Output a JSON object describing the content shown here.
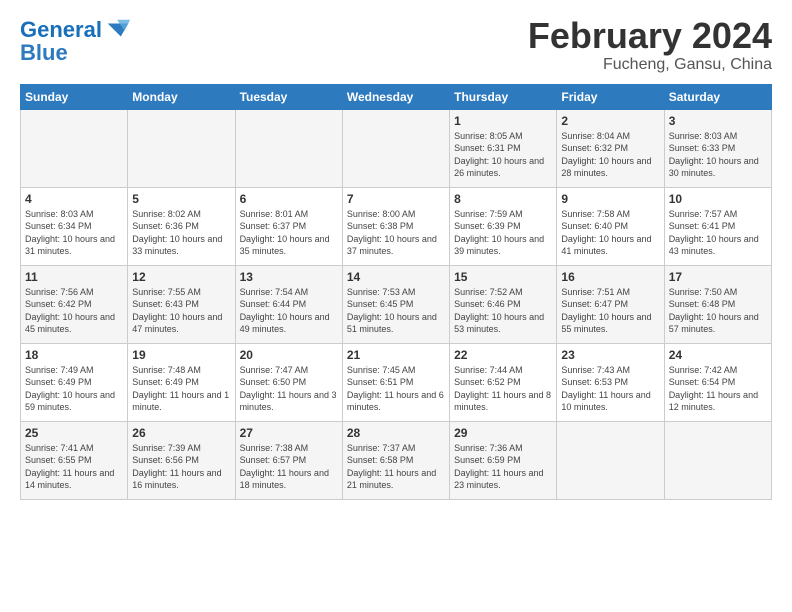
{
  "logo": {
    "line1": "General",
    "line2": "Blue"
  },
  "title": "February 2024",
  "subtitle": "Fucheng, Gansu, China",
  "headers": [
    "Sunday",
    "Monday",
    "Tuesday",
    "Wednesday",
    "Thursday",
    "Friday",
    "Saturday"
  ],
  "weeks": [
    [
      {
        "day": "",
        "sunrise": "",
        "sunset": "",
        "daylight": ""
      },
      {
        "day": "",
        "sunrise": "",
        "sunset": "",
        "daylight": ""
      },
      {
        "day": "",
        "sunrise": "",
        "sunset": "",
        "daylight": ""
      },
      {
        "day": "",
        "sunrise": "",
        "sunset": "",
        "daylight": ""
      },
      {
        "day": "1",
        "sunrise": "Sunrise: 8:05 AM",
        "sunset": "Sunset: 6:31 PM",
        "daylight": "Daylight: 10 hours and 26 minutes."
      },
      {
        "day": "2",
        "sunrise": "Sunrise: 8:04 AM",
        "sunset": "Sunset: 6:32 PM",
        "daylight": "Daylight: 10 hours and 28 minutes."
      },
      {
        "day": "3",
        "sunrise": "Sunrise: 8:03 AM",
        "sunset": "Sunset: 6:33 PM",
        "daylight": "Daylight: 10 hours and 30 minutes."
      }
    ],
    [
      {
        "day": "4",
        "sunrise": "Sunrise: 8:03 AM",
        "sunset": "Sunset: 6:34 PM",
        "daylight": "Daylight: 10 hours and 31 minutes."
      },
      {
        "day": "5",
        "sunrise": "Sunrise: 8:02 AM",
        "sunset": "Sunset: 6:36 PM",
        "daylight": "Daylight: 10 hours and 33 minutes."
      },
      {
        "day": "6",
        "sunrise": "Sunrise: 8:01 AM",
        "sunset": "Sunset: 6:37 PM",
        "daylight": "Daylight: 10 hours and 35 minutes."
      },
      {
        "day": "7",
        "sunrise": "Sunrise: 8:00 AM",
        "sunset": "Sunset: 6:38 PM",
        "daylight": "Daylight: 10 hours and 37 minutes."
      },
      {
        "day": "8",
        "sunrise": "Sunrise: 7:59 AM",
        "sunset": "Sunset: 6:39 PM",
        "daylight": "Daylight: 10 hours and 39 minutes."
      },
      {
        "day": "9",
        "sunrise": "Sunrise: 7:58 AM",
        "sunset": "Sunset: 6:40 PM",
        "daylight": "Daylight: 10 hours and 41 minutes."
      },
      {
        "day": "10",
        "sunrise": "Sunrise: 7:57 AM",
        "sunset": "Sunset: 6:41 PM",
        "daylight": "Daylight: 10 hours and 43 minutes."
      }
    ],
    [
      {
        "day": "11",
        "sunrise": "Sunrise: 7:56 AM",
        "sunset": "Sunset: 6:42 PM",
        "daylight": "Daylight: 10 hours and 45 minutes."
      },
      {
        "day": "12",
        "sunrise": "Sunrise: 7:55 AM",
        "sunset": "Sunset: 6:43 PM",
        "daylight": "Daylight: 10 hours and 47 minutes."
      },
      {
        "day": "13",
        "sunrise": "Sunrise: 7:54 AM",
        "sunset": "Sunset: 6:44 PM",
        "daylight": "Daylight: 10 hours and 49 minutes."
      },
      {
        "day": "14",
        "sunrise": "Sunrise: 7:53 AM",
        "sunset": "Sunset: 6:45 PM",
        "daylight": "Daylight: 10 hours and 51 minutes."
      },
      {
        "day": "15",
        "sunrise": "Sunrise: 7:52 AM",
        "sunset": "Sunset: 6:46 PM",
        "daylight": "Daylight: 10 hours and 53 minutes."
      },
      {
        "day": "16",
        "sunrise": "Sunrise: 7:51 AM",
        "sunset": "Sunset: 6:47 PM",
        "daylight": "Daylight: 10 hours and 55 minutes."
      },
      {
        "day": "17",
        "sunrise": "Sunrise: 7:50 AM",
        "sunset": "Sunset: 6:48 PM",
        "daylight": "Daylight: 10 hours and 57 minutes."
      }
    ],
    [
      {
        "day": "18",
        "sunrise": "Sunrise: 7:49 AM",
        "sunset": "Sunset: 6:49 PM",
        "daylight": "Daylight: 10 hours and 59 minutes."
      },
      {
        "day": "19",
        "sunrise": "Sunrise: 7:48 AM",
        "sunset": "Sunset: 6:49 PM",
        "daylight": "Daylight: 11 hours and 1 minute."
      },
      {
        "day": "20",
        "sunrise": "Sunrise: 7:47 AM",
        "sunset": "Sunset: 6:50 PM",
        "daylight": "Daylight: 11 hours and 3 minutes."
      },
      {
        "day": "21",
        "sunrise": "Sunrise: 7:45 AM",
        "sunset": "Sunset: 6:51 PM",
        "daylight": "Daylight: 11 hours and 6 minutes."
      },
      {
        "day": "22",
        "sunrise": "Sunrise: 7:44 AM",
        "sunset": "Sunset: 6:52 PM",
        "daylight": "Daylight: 11 hours and 8 minutes."
      },
      {
        "day": "23",
        "sunrise": "Sunrise: 7:43 AM",
        "sunset": "Sunset: 6:53 PM",
        "daylight": "Daylight: 11 hours and 10 minutes."
      },
      {
        "day": "24",
        "sunrise": "Sunrise: 7:42 AM",
        "sunset": "Sunset: 6:54 PM",
        "daylight": "Daylight: 11 hours and 12 minutes."
      }
    ],
    [
      {
        "day": "25",
        "sunrise": "Sunrise: 7:41 AM",
        "sunset": "Sunset: 6:55 PM",
        "daylight": "Daylight: 11 hours and 14 minutes."
      },
      {
        "day": "26",
        "sunrise": "Sunrise: 7:39 AM",
        "sunset": "Sunset: 6:56 PM",
        "daylight": "Daylight: 11 hours and 16 minutes."
      },
      {
        "day": "27",
        "sunrise": "Sunrise: 7:38 AM",
        "sunset": "Sunset: 6:57 PM",
        "daylight": "Daylight: 11 hours and 18 minutes."
      },
      {
        "day": "28",
        "sunrise": "Sunrise: 7:37 AM",
        "sunset": "Sunset: 6:58 PM",
        "daylight": "Daylight: 11 hours and 21 minutes."
      },
      {
        "day": "29",
        "sunrise": "Sunrise: 7:36 AM",
        "sunset": "Sunset: 6:59 PM",
        "daylight": "Daylight: 11 hours and 23 minutes."
      },
      {
        "day": "",
        "sunrise": "",
        "sunset": "",
        "daylight": ""
      },
      {
        "day": "",
        "sunrise": "",
        "sunset": "",
        "daylight": ""
      }
    ]
  ]
}
